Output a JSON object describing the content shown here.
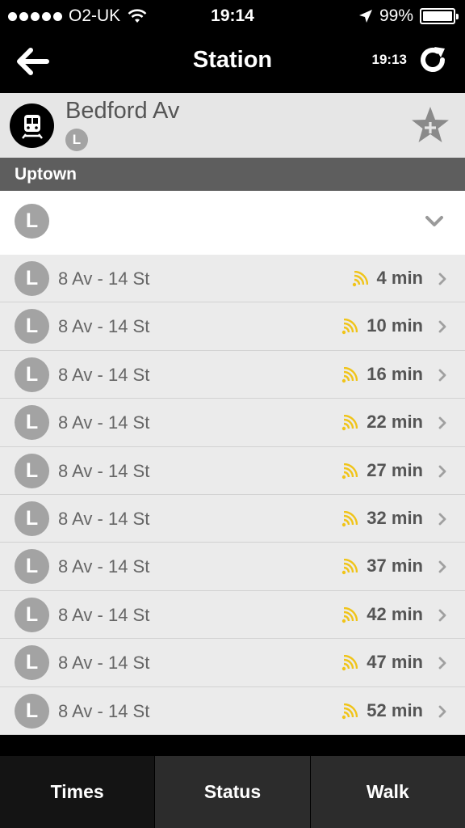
{
  "status_bar": {
    "carrier": "O2-UK",
    "time": "19:14",
    "battery": "99%",
    "battery_level": 0.99,
    "signal_bars": 5
  },
  "nav": {
    "title": "Station",
    "updated_time": "19:13",
    "icons": {
      "back": "back-arrow-icon",
      "refresh": "refresh-icon"
    }
  },
  "station": {
    "name": "Bedford Av",
    "line": "L",
    "icons": {
      "logo": "train-icon",
      "favorite": "add-favorite-star-icon"
    }
  },
  "direction": "Uptown",
  "filter": {
    "line": "L"
  },
  "arrivals": [
    {
      "line": "L",
      "destination": "8 Av - 14 St",
      "eta": "4 min"
    },
    {
      "line": "L",
      "destination": "8 Av - 14 St",
      "eta": "10 min"
    },
    {
      "line": "L",
      "destination": "8 Av - 14 St",
      "eta": "16 min"
    },
    {
      "line": "L",
      "destination": "8 Av - 14 St",
      "eta": "22 min"
    },
    {
      "line": "L",
      "destination": "8 Av - 14 St",
      "eta": "27 min"
    },
    {
      "line": "L",
      "destination": "8 Av - 14 St",
      "eta": "32 min"
    },
    {
      "line": "L",
      "destination": "8 Av - 14 St",
      "eta": "37 min"
    },
    {
      "line": "L",
      "destination": "8 Av - 14 St",
      "eta": "42 min"
    },
    {
      "line": "L",
      "destination": "8 Av - 14 St",
      "eta": "47 min"
    },
    {
      "line": "L",
      "destination": "8 Av - 14 St",
      "eta": "52 min"
    }
  ],
  "tabs": [
    {
      "label": "Times",
      "active": true
    },
    {
      "label": "Status",
      "active": false
    },
    {
      "label": "Walk",
      "active": false
    }
  ],
  "colors": {
    "line_badge": "#a3a3a3",
    "realtime": "#f0c419",
    "direction_header": "#5e5e5e"
  }
}
